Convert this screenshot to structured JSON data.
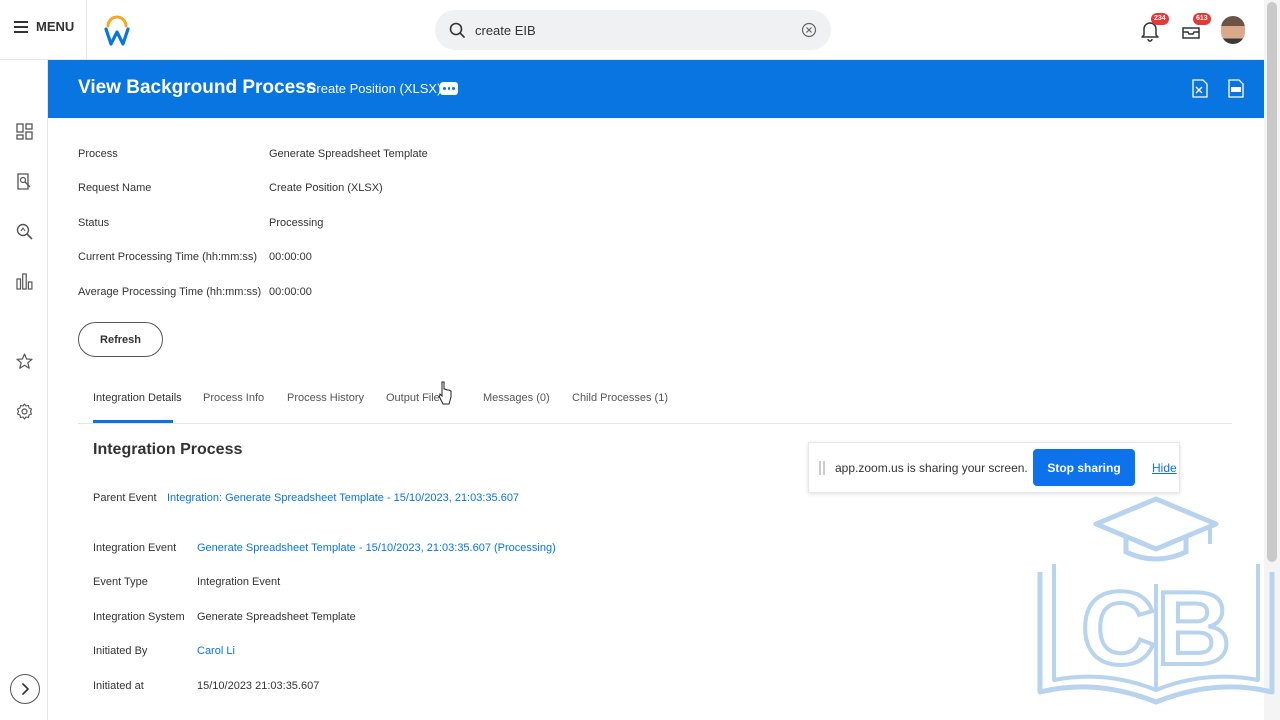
{
  "topbar": {
    "menu_label": "MENU",
    "search_value": "create EIB",
    "notifications_count": "234",
    "inbox_count": "613"
  },
  "header": {
    "title": "View Background Process",
    "subtitle": "Create Position (XLSX)"
  },
  "fields": [
    {
      "label": "Process",
      "value": "Generate Spreadsheet Template"
    },
    {
      "label": "Request Name",
      "value": "Create Position (XLSX)"
    },
    {
      "label": "Status",
      "value": "Processing"
    },
    {
      "label": "Current Processing Time (hh:mm:ss)",
      "value": "00:00:00"
    },
    {
      "label": "Average Processing Time (hh:mm:ss)",
      "value": "00:00:00"
    }
  ],
  "refresh_label": "Refresh",
  "tabs": [
    {
      "label": "Integration Details",
      "active": true
    },
    {
      "label": "Process Info"
    },
    {
      "label": "Process History"
    },
    {
      "label": "Output Files"
    },
    {
      "label": "Messages (0)"
    },
    {
      "label": "Child Processes (1)"
    }
  ],
  "integration": {
    "title": "Integration Process",
    "parent_event_label": "Parent Event",
    "parent_event_value": "Integration: Generate Spreadsheet Template - 15/10/2023, 21:03:35.607",
    "details": [
      {
        "label": "Integration Event",
        "value": "Generate Spreadsheet Template - 15/10/2023, 21:03:35.607 (Processing)"
      },
      {
        "label": "Event Type",
        "value": "Integration Event"
      },
      {
        "label": "Integration System",
        "value": "Generate Spreadsheet Template"
      },
      {
        "label": "Initiated By",
        "value": "Carol Li"
      },
      {
        "label": "Initiated at",
        "value": "15/10/2023 21:03:35.607"
      }
    ]
  },
  "zoom": {
    "message": "app.zoom.us is sharing your screen.",
    "stop_label": "Stop sharing",
    "hide_label": "Hide"
  },
  "watermark": {
    "text": "CB"
  },
  "colors": {
    "brand_blue": "#0875e1",
    "zoom_blue": "#0e72ed",
    "badge_red": "#e53935"
  }
}
